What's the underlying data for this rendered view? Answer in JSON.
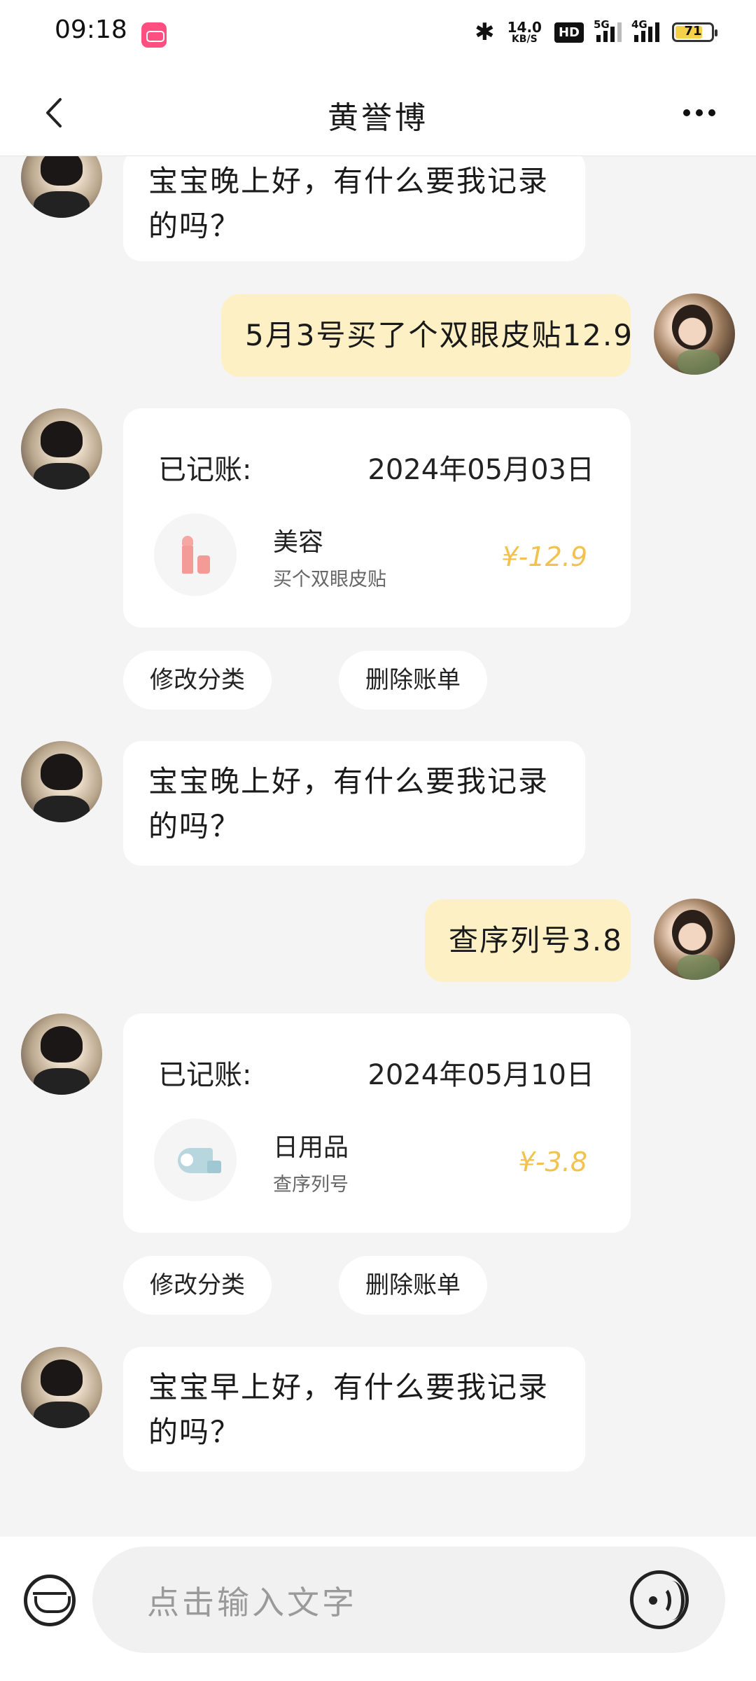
{
  "status": {
    "time": "09:18",
    "speed_value": "14.0",
    "speed_unit": "KB/S",
    "hd": "HD",
    "sig1": "5G",
    "sig2": "4G",
    "battery": "71"
  },
  "header": {
    "title": "黄誉博"
  },
  "chat": {
    "greet1": "宝宝晚上好，有什么要我记录的吗？",
    "user1": "5月3号买了个双眼皮贴12.9",
    "card1": {
      "label": "已记账:",
      "date": "2024年05月03日",
      "category": "美容",
      "note": "买个双眼皮贴",
      "amount": "¥-12.9"
    },
    "greet2": "宝宝晚上好，有什么要我记录的吗？",
    "user2": "查序列号3.8",
    "card2": {
      "label": "已记账:",
      "date": "2024年05月10日",
      "category": "日用品",
      "note": "查序列号",
      "amount": "¥-3.8"
    },
    "greet3": "宝宝早上好，有什么要我记录的吗？"
  },
  "actions": {
    "edit": "修改分类",
    "delete": "删除账单"
  },
  "input": {
    "placeholder": "点击输入文字"
  }
}
